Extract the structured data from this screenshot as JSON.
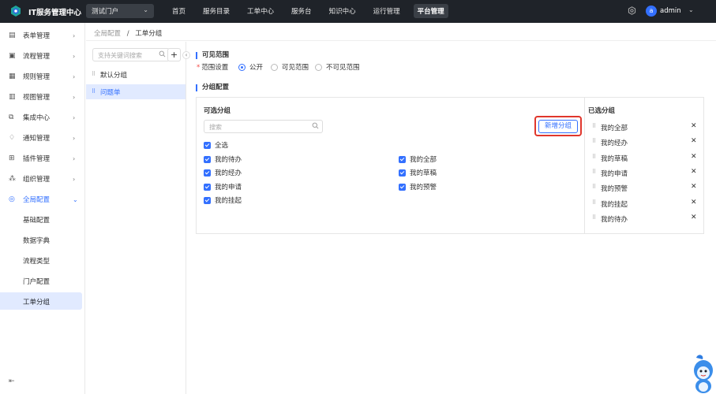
{
  "header": {
    "app_title": "IT服务管理中心",
    "portal": "测试门户",
    "nav": [
      "首页",
      "服务目录",
      "工单中心",
      "服务台",
      "知识中心",
      "运行管理",
      "平台管理"
    ],
    "active_nav": "平台管理",
    "user": {
      "avatar_letter": "a",
      "name": "admin"
    }
  },
  "sidebar": {
    "items": [
      {
        "label": "表单管理",
        "icon": "form-icon"
      },
      {
        "label": "流程管理",
        "icon": "flow-icon"
      },
      {
        "label": "规则管理",
        "icon": "rule-icon"
      },
      {
        "label": "视图管理",
        "icon": "view-icon"
      },
      {
        "label": "集成中心",
        "icon": "integration-icon"
      },
      {
        "label": "通知管理",
        "icon": "bell-icon"
      },
      {
        "label": "插件管理",
        "icon": "plugin-icon"
      },
      {
        "label": "组织管理",
        "icon": "org-icon"
      },
      {
        "label": "全局配置",
        "icon": "globe-icon"
      }
    ],
    "sub_items": [
      "基础配置",
      "数据字典",
      "流程类型",
      "门户配置",
      "工单分组"
    ],
    "active_sub": "工单分组"
  },
  "breadcrumb": {
    "parent": "全局配置",
    "separator": "/",
    "current": "工单分组"
  },
  "group_panel": {
    "search_placeholder": "支持关键词搜索",
    "add_label": "+",
    "groups": [
      "默认分组",
      "问题单"
    ],
    "active_group": "问题单"
  },
  "visibility": {
    "title": "可见范围",
    "field_label": "范围设置",
    "options": [
      "公开",
      "可见范围",
      "不可见范围"
    ],
    "selected": "公开"
  },
  "group_config": {
    "title": "分组配置",
    "available_title": "可选分组",
    "search_placeholder": "搜索",
    "new_group_button": "新增分组",
    "select_all": "全选",
    "available": [
      "我的待办",
      "我的经办",
      "我的申请",
      "我的挂起",
      "我的全部",
      "我的草稿",
      "我的预警"
    ],
    "selected_title": "已选分组",
    "selected": [
      "我的全部",
      "我的经办",
      "我的草稿",
      "我的申请",
      "我的预警",
      "我的挂起",
      "我的待办"
    ],
    "remove_glyph": "✕"
  },
  "colors": {
    "primary": "#3370ff",
    "topbar": "#1f2329",
    "highlight_outline": "#e0362c"
  }
}
